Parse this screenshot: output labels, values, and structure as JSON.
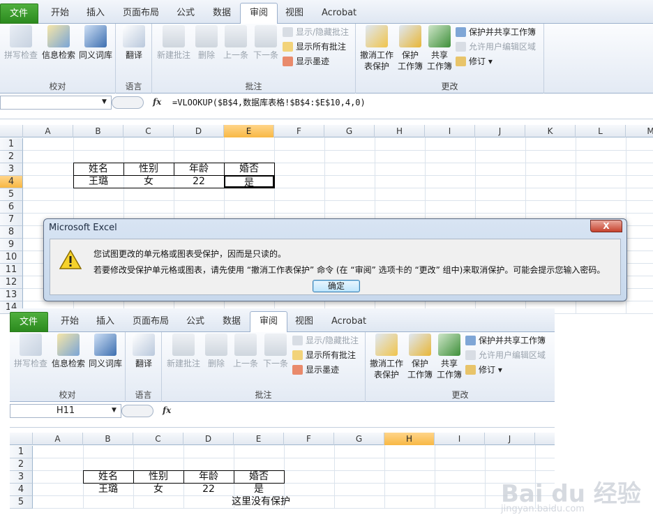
{
  "tabs": [
    "文件",
    "开始",
    "插入",
    "页面布局",
    "公式",
    "数据",
    "审阅",
    "视图",
    "Acrobat"
  ],
  "active_tab": "审阅",
  "ribbon": {
    "proofing": {
      "spell": "拼写检查",
      "research": "信息检索",
      "thesaurus": "同义词库",
      "group": "校对"
    },
    "language": {
      "translate": "翻译",
      "group": "语言"
    },
    "comments": {
      "new": "新建批注",
      "delete": "删除",
      "prev": "上一条",
      "next": "下一条",
      "show_hide": "显示/隐藏批注",
      "show_all": "显示所有批注",
      "show_ink": "显示墨迹",
      "group": "批注"
    },
    "changes": {
      "unprotect_sheet_1": "撤消工作",
      "unprotect_sheet_2": "表保护",
      "protect_wb_1": "保护",
      "protect_wb_2": "工作簿",
      "share_wb_1": "共享",
      "share_wb_2": "工作簿",
      "protect_share": "保护并共享工作簿",
      "allow_edit": "允许用户编辑区域",
      "track": "修订",
      "group": "更改"
    }
  },
  "top": {
    "namebox": "",
    "formula": "=VLOOKUP($B$4,数据库表格!$B$4:$E$10,4,0)",
    "columns": [
      "A",
      "B",
      "C",
      "D",
      "E",
      "F",
      "G",
      "H",
      "I",
      "J",
      "K",
      "L",
      "M"
    ],
    "rows": [
      "1",
      "2",
      "3",
      "4",
      "5",
      "6",
      "7",
      "8",
      "9",
      "10",
      "11",
      "12",
      "13",
      "14"
    ],
    "table": {
      "h1": "姓名",
      "h2": "性别",
      "h3": "年龄",
      "h4": "婚否",
      "v1": "王璐",
      "v2": "女",
      "v3": "22",
      "v4": "是"
    }
  },
  "dialog": {
    "title": "Microsoft Excel",
    "close": "X",
    "line1": "您试图更改的单元格或图表受保护，因而是只读的。",
    "line2": "若要修改受保护单元格或图表，请先使用 “撤消工作表保护” 命令 (在 “审阅” 选项卡的 “更改” 组中)来取消保护。可能会提示您输入密码。",
    "ok": "确定"
  },
  "bottom": {
    "namebox": "H11",
    "formula": "",
    "columns": [
      "A",
      "B",
      "C",
      "D",
      "E",
      "F",
      "G",
      "H",
      "I",
      "J"
    ],
    "rows": [
      "1",
      "2",
      "3",
      "4",
      "5"
    ],
    "table": {
      "h1": "姓名",
      "h2": "性别",
      "h3": "年龄",
      "h4": "婚否",
      "v1": "王璐",
      "v2": "女",
      "v3": "22",
      "v4": "是"
    },
    "note": "这里没有保护"
  },
  "watermark": {
    "logo": "Bai du 经验",
    "url": "jingyan.baidu.com"
  },
  "colors": {
    "file_tab": "#2b8a1e",
    "selected_header": "#f8b844",
    "ribbon_bg": "#e3eaf4"
  }
}
